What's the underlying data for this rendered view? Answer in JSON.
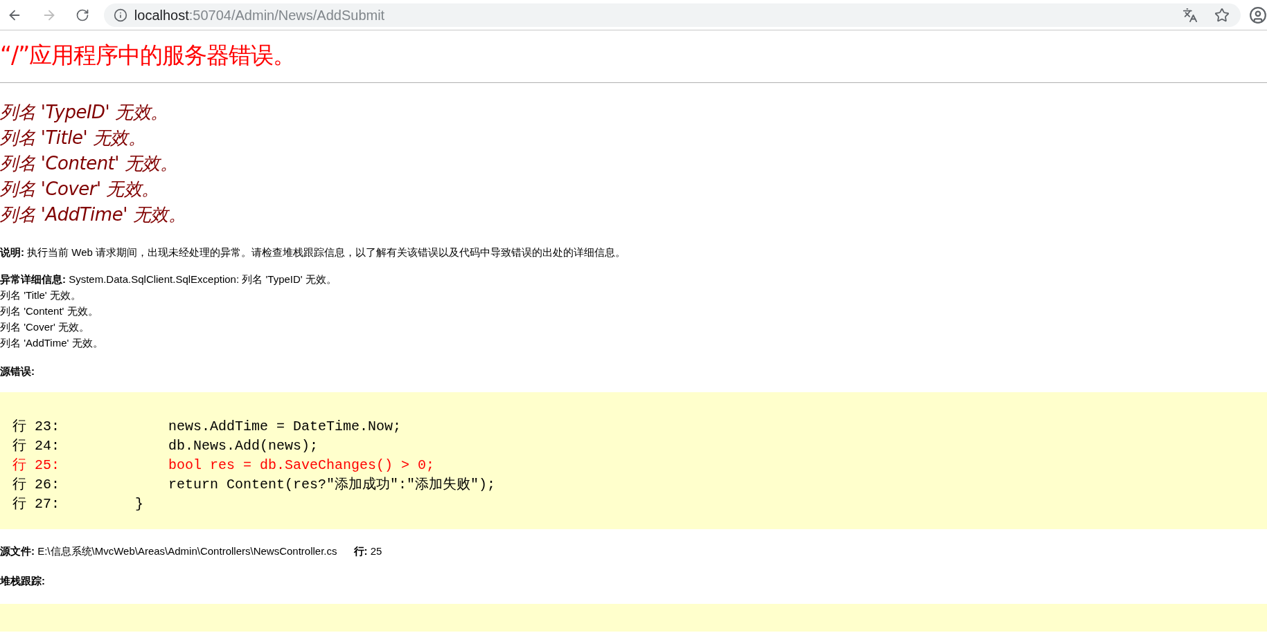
{
  "browser": {
    "back_disabled": false,
    "forward_disabled": true,
    "url_host": "localhost",
    "url_rest": ":50704/Admin/News/AddSubmit",
    "bookmarked": false
  },
  "title": "“/”应用程序中的服务器错误。",
  "error_messages": [
    "列名 'TypeID' 无效。",
    "列名 'Title' 无效。",
    "列名 'Content' 无效。",
    "列名 'Cover' 无效。",
    "列名 'AddTime' 无效。"
  ],
  "description": "**说明:** 执行当前 Web 请求期间，出现未经处理的异常。请检查堆栈跟踪信息，以了解有关该错误以及代码中导致错误的出处的详细信息。",
  "exception_details": [
    "**异常详细信息:** System.Data.SqlClient.SqlException: 列名 'TypeID' 无效。",
    "列名 'Title' 无效。",
    "列名 'Content' 无效。",
    "列名 'Cover' 无效。",
    "列名 'AddTime' 无效。"
  ],
  "source_error_label": "源错误:",
  "source_lines": [
    {
      "number": "行 23:",
      "code": "            news.AddTime = DateTime.Now;",
      "highlighted": false
    },
    {
      "number": "行 24:",
      "code": "            db.News.Add(news);",
      "highlighted": false
    },
    {
      "number": "行 25:",
      "code": "            bool res = db.SaveChanges() > 0;",
      "highlighted": true
    },
    {
      "number": "行 26:",
      "code": "            return Content(res?\"添加成功\":\"添加失败\");",
      "highlighted": false
    },
    {
      "number": "行 27:",
      "code": "        }",
      "highlighted": false
    }
  ],
  "source_file": "**源文件:** E:\\信息系统\\MvcWeb\\Areas\\Admin\\Controllers\\NewsController.cs",
  "source_line": "**行:** 25",
  "stack_trace_label": "堆栈跟踪:"
}
